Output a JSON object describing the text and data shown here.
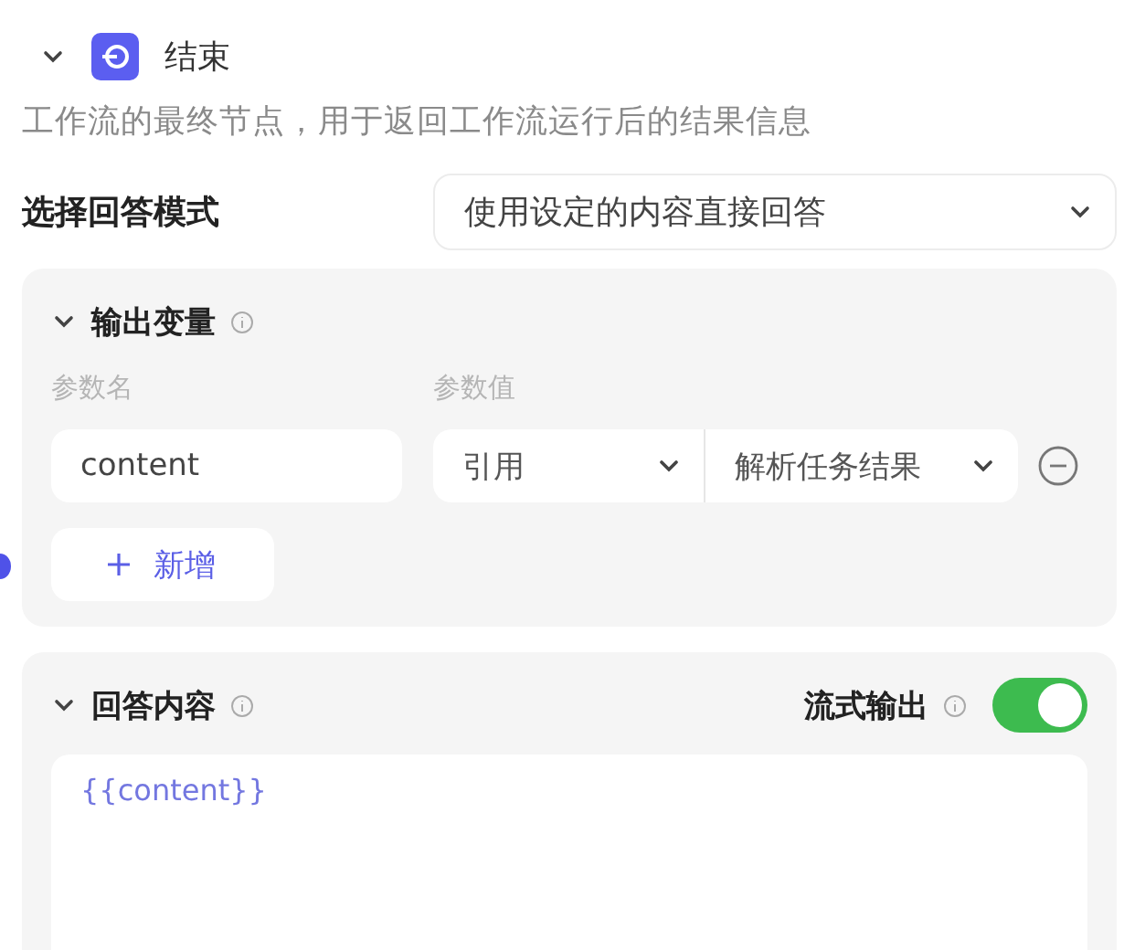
{
  "node": {
    "title": "结束",
    "expanded": true,
    "description": "工作流的最终节点，用于返回工作流运行后的结果信息"
  },
  "mode": {
    "label": "选择回答模式",
    "value": "使用设定的内容直接回答"
  },
  "output_variables": {
    "title": "输出变量",
    "expanded": true,
    "name_header": "参数名",
    "value_header": "参数值",
    "rows": [
      {
        "name": "content",
        "source": "引用",
        "value": "解析任务结果"
      }
    ],
    "add_button": "新增"
  },
  "answer_content": {
    "title": "回答内容",
    "expanded": true,
    "streaming_label": "流式输出",
    "streaming_on": true,
    "content": "{{content}}"
  }
}
